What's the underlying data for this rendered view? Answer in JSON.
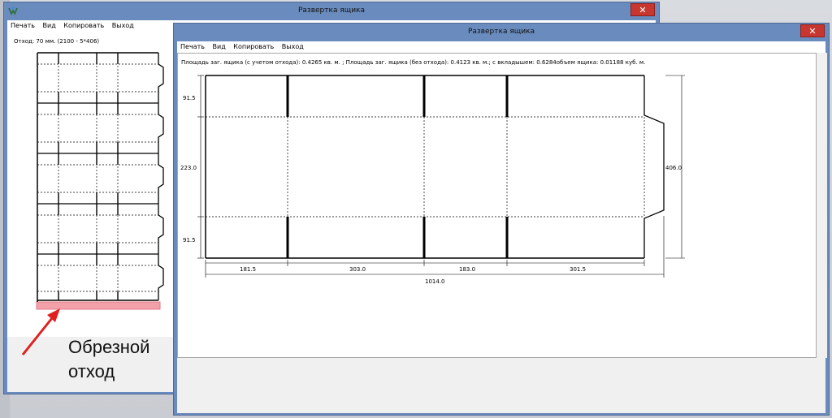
{
  "window_back": {
    "title": "Развертка ящика",
    "menu": [
      "Печать",
      "Вид",
      "Копировать",
      "Выход"
    ],
    "waste_label": "Отход: 70 мм. (2100 - 5*406)"
  },
  "window_front": {
    "title": "Развертка ящика",
    "menu": [
      "Печать",
      "Вид",
      "Копировать",
      "Выход"
    ],
    "info_line": "Площадь заг. ящика (с учетом отхода): 0.4265 кв. м. ; Площадь заг. ящика (без отхода): 0.4123 кв. м.; с вкладышем: 0.6284объем ящика: 0.01188 куб. м.",
    "dims": {
      "left_top": "91.5",
      "left_mid": "223.0",
      "left_bottom": "91.5",
      "right_total": "406.0",
      "bottom_1": "181.5",
      "bottom_2": "303.0",
      "bottom_3": "183.0",
      "bottom_4": "301.5",
      "bottom_total": "1014.0"
    }
  },
  "annotation": {
    "line1": "Обрезной",
    "line2": "отход",
    "arrow_color": "#e02020",
    "highlight_color": "#f3a0a8"
  },
  "colors": {
    "titlebar": "#6a8bbd",
    "close": "#c7372f"
  }
}
